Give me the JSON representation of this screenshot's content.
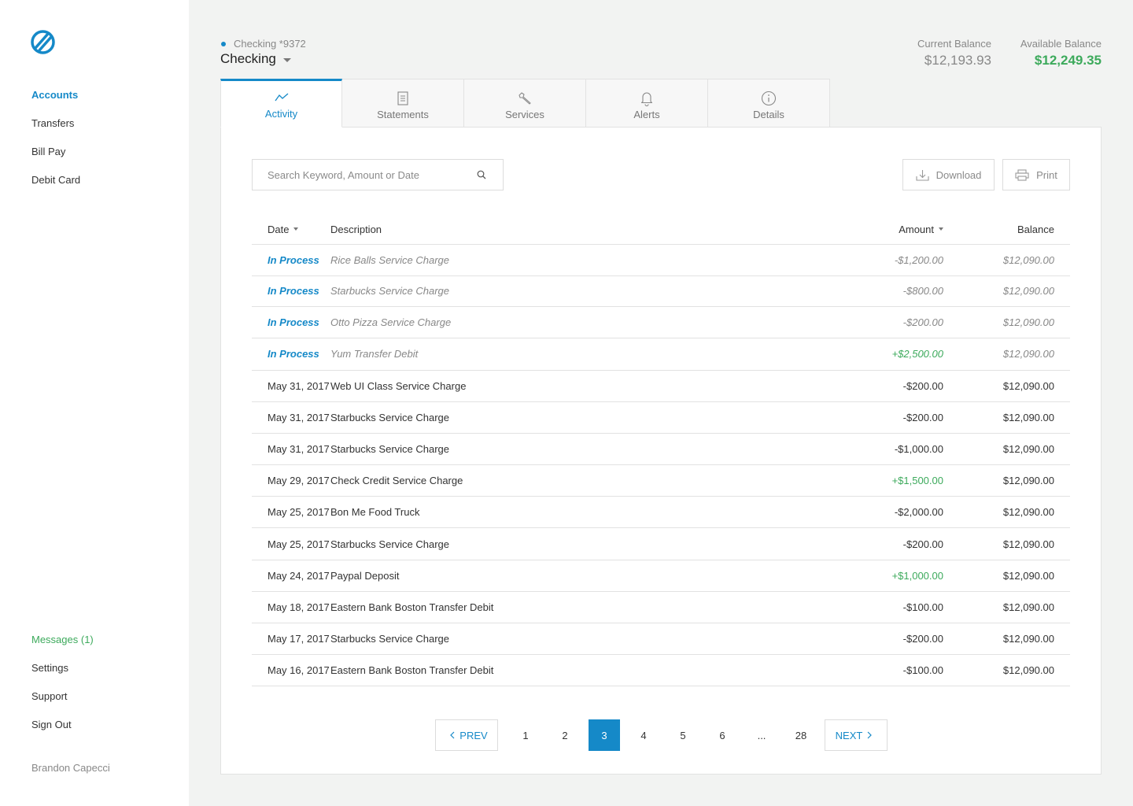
{
  "sidebar": {
    "nav": [
      "Accounts",
      "Transfers",
      "Bill Pay",
      "Debit Card"
    ],
    "bottom": [
      "Messages (1)",
      "Settings",
      "Support",
      "Sign Out"
    ],
    "user": "Brandon Capecci"
  },
  "account": {
    "subtitle": "Checking *9372",
    "title": "Checking"
  },
  "balances": {
    "current_label": "Current Balance",
    "current_value": "$12,193.93",
    "available_label": "Available Balance",
    "available_value": "$12,249.35"
  },
  "tabs": [
    "Activity",
    "Statements",
    "Services",
    "Alerts",
    "Details"
  ],
  "toolbar": {
    "search_placeholder": "Search Keyword, Amount or Date",
    "download_label": "Download",
    "print_label": "Print"
  },
  "table": {
    "headers": {
      "date": "Date",
      "description": "Description",
      "amount": "Amount",
      "balance": "Balance"
    },
    "pending": [
      {
        "date": "In Process",
        "description": "Rice Balls Service Charge",
        "amount": "-$1,200.00",
        "balance": "$12,090.00"
      },
      {
        "date": "In Process",
        "description": "Starbucks Service Charge",
        "amount": "-$800.00",
        "balance": "$12,090.00"
      },
      {
        "date": "In Process",
        "description": "Otto Pizza Service Charge",
        "amount": "-$200.00",
        "balance": "$12,090.00"
      },
      {
        "date": "In Process",
        "description": "Yum Transfer Debit",
        "amount": "+$2,500.00",
        "balance": "$12,090.00"
      }
    ],
    "posted": [
      {
        "date": "May 31, 2017",
        "description": "Web UI Class Service Charge",
        "amount": "-$200.00",
        "balance": "$12,090.00"
      },
      {
        "date": "May 31, 2017",
        "description": "Starbucks Service Charge",
        "amount": "-$200.00",
        "balance": "$12,090.00"
      },
      {
        "date": "May 31, 2017",
        "description": "Starbucks Service Charge",
        "amount": "-$1,000.00",
        "balance": "$12,090.00"
      },
      {
        "date": "May 29, 2017",
        "description": "Check Credit Service Charge",
        "amount": "+$1,500.00",
        "balance": "$12,090.00"
      },
      {
        "date": "May 25, 2017",
        "description": "Bon Me Food Truck",
        "amount": "-$2,000.00",
        "balance": "$12,090.00"
      },
      {
        "date": "May 25, 2017",
        "description": "Starbucks Service Charge",
        "amount": "-$200.00",
        "balance": "$12,090.00"
      },
      {
        "date": "May 24, 2017",
        "description": "Paypal Deposit",
        "amount": "+$1,000.00",
        "balance": "$12,090.00"
      },
      {
        "date": "May 18, 2017",
        "description": "Eastern Bank Boston Transfer Debit",
        "amount": "-$100.00",
        "balance": "$12,090.00"
      },
      {
        "date": "May 17, 2017",
        "description": "Starbucks Service Charge",
        "amount": "-$200.00",
        "balance": "$12,090.00"
      },
      {
        "date": "May 16, 2017",
        "description": "Eastern Bank Boston Transfer Debit",
        "amount": "-$100.00",
        "balance": "$12,090.00"
      }
    ]
  },
  "pagination": {
    "prev": "PREV",
    "next": "NEXT",
    "pages": [
      "1",
      "2",
      "3",
      "4",
      "5",
      "6",
      "...",
      "28"
    ],
    "current": "3"
  },
  "colors": {
    "accent": "#1589c8",
    "positive": "#3daa5c"
  }
}
